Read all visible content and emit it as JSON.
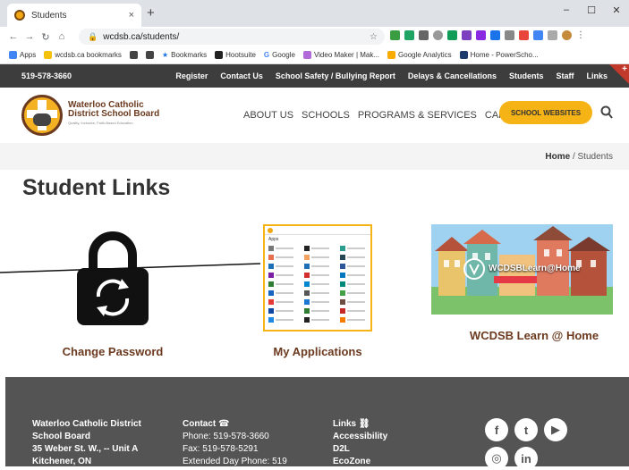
{
  "browser": {
    "tab_title": "Students",
    "tab_close": "×",
    "new_tab": "+",
    "url": "wcdsb.ca/students/",
    "win_min": "–",
    "win_max": "☐",
    "win_close": "✕"
  },
  "bookmarks": [
    "Apps",
    "wcdsb.ca bookmarks",
    "Bookmarks",
    "Hootsuite",
    "Google",
    "Video Maker | Mak...",
    "Google Analytics",
    "Home - PowerScho..."
  ],
  "site": {
    "phone": "519-578-3660",
    "topnav": [
      "Register",
      "Contact Us",
      "School Safety / Bullying Report",
      "Delays & Cancellations",
      "Students",
      "Staff",
      "Links"
    ],
    "corner_plus": "+",
    "brand_line1": "Waterloo Catholic",
    "brand_line2": "District School Board",
    "brand_tagline": "Quality, Inclusive, Faith-Based Education",
    "mainnav": [
      "ABOUT US",
      "SCHOOLS",
      "PROGRAMS & SERVICES",
      "CAREERS"
    ],
    "school_websites": "SCHOOL WEBSITES",
    "crumb_home": "Home",
    "crumb_sep": " / ",
    "crumb_current": "Students",
    "page_title": "Student Links"
  },
  "cards": {
    "change_password": "Change Password",
    "my_applications": "My Applications",
    "learn_at_home": "WCDSB Learn @ Home",
    "learn_banner_text": "WCDSBLearn@Home",
    "apps_heading": "Apps"
  },
  "footer": {
    "addr1": "Waterloo Catholic District",
    "addr2": "School Board",
    "addr3": "35 Weber St. W., -- Unit A",
    "addr4": "Kitchener, ON",
    "contact_h": "Contact",
    "phone": "Phone: 519-578-3660",
    "fax": "Fax: 519-578-5291",
    "extended": "Extended Day Phone: 519",
    "links_h": "Links",
    "link1": "Accessibility",
    "link2": "D2L",
    "link3": "EcoZone"
  },
  "colors": {
    "brown": "#6b3a1f",
    "gold": "#f5b316",
    "dark": "#3d3d3d"
  }
}
